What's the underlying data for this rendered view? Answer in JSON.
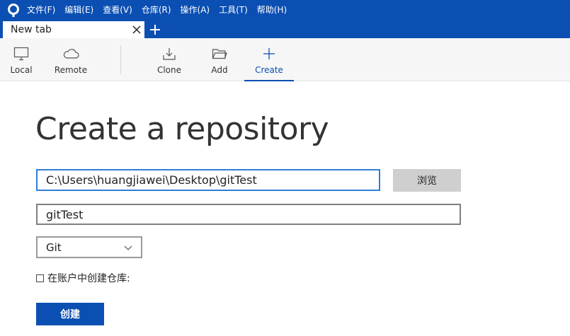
{
  "menu": {
    "items": [
      {
        "label": "文件(F)"
      },
      {
        "label": "编辑(E)"
      },
      {
        "label": "查看(V)"
      },
      {
        "label": "仓库(R)"
      },
      {
        "label": "操作(A)"
      },
      {
        "label": "工具(T)"
      },
      {
        "label": "帮助(H)"
      }
    ]
  },
  "tabs": {
    "active_label": "New tab",
    "close_icon": "close-icon",
    "new_tab_icon": "plus-icon"
  },
  "toolbar": {
    "local": {
      "label": "Local",
      "icon": "monitor-icon"
    },
    "remote": {
      "label": "Remote",
      "icon": "cloud-icon"
    },
    "clone": {
      "label": "Clone",
      "icon": "download-icon"
    },
    "add": {
      "label": "Add",
      "icon": "folder-icon"
    },
    "create": {
      "label": "Create",
      "icon": "plus-icon",
      "active": true
    }
  },
  "main": {
    "title": "Create a repository",
    "path_value": "C:\\Users\\huangjiawei\\Desktop\\gitTest",
    "browse_label": "浏览",
    "name_value": "gitTest",
    "vcs_selected": "Git",
    "account_checkbox_label": "在账户中创建仓库:",
    "account_checkbox_checked": false,
    "create_label": "创建"
  },
  "colors": {
    "accent": "#0b4fb3",
    "input_focus": "#2f7ed8",
    "button_gray": "#cfcfcf"
  }
}
